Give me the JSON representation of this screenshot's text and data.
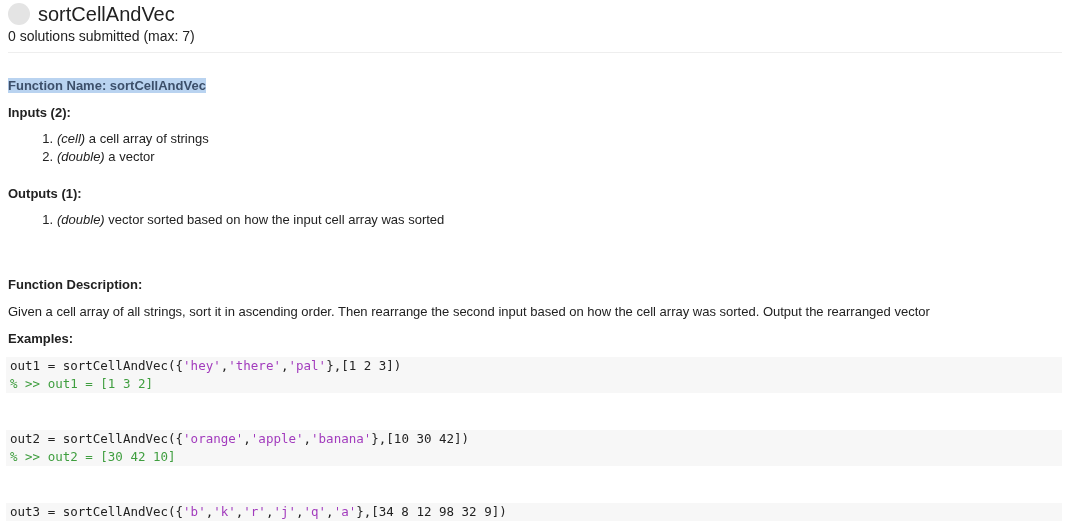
{
  "header": {
    "title": "sortCellAndVec",
    "subtitle": "0 solutions submitted (max: 7)"
  },
  "function_name": {
    "text": "Function Name: sortCellAndVec",
    "selected": true
  },
  "inputs": {
    "heading": "Inputs (2):",
    "items": [
      {
        "marker": "1.",
        "type": "(cell)",
        "text": "a cell array of strings"
      },
      {
        "marker": "2.",
        "type": "(double)",
        "text": "a vector"
      }
    ]
  },
  "outputs": {
    "heading": "Outputs (1):",
    "items": [
      {
        "marker": "1.",
        "type": "(double)",
        "text": "vector sorted based on how the input cell array was sorted"
      }
    ]
  },
  "description": {
    "heading": "Function Description:",
    "text": "Given a cell array of all strings, sort it in ascending order. Then rearrange the second input based on how the cell array was sorted. Output the rearranged vector"
  },
  "examples": {
    "heading": "Examples:",
    "blocks": [
      {
        "lines": [
          [
            {
              "kind": "plain",
              "text": "out1 = sortCellAndVec({"
            },
            {
              "kind": "string",
              "text": "'hey'"
            },
            {
              "kind": "plain",
              "text": ","
            },
            {
              "kind": "string",
              "text": "'there'"
            },
            {
              "kind": "plain",
              "text": ","
            },
            {
              "kind": "string",
              "text": "'pal'"
            },
            {
              "kind": "plain",
              "text": "},[1 2 3])"
            }
          ],
          [
            {
              "kind": "comment",
              "text": "% >> out1 = [1 3 2]"
            }
          ]
        ]
      },
      {
        "lines": [
          [
            {
              "kind": "plain",
              "text": "out2 = sortCellAndVec({"
            },
            {
              "kind": "string",
              "text": "'orange'"
            },
            {
              "kind": "plain",
              "text": ","
            },
            {
              "kind": "string",
              "text": "'apple'"
            },
            {
              "kind": "plain",
              "text": ","
            },
            {
              "kind": "string",
              "text": "'banana'"
            },
            {
              "kind": "plain",
              "text": "},[10 30 42])"
            }
          ],
          [
            {
              "kind": "comment",
              "text": "% >> out2 = [30 42 10]"
            }
          ]
        ]
      },
      {
        "lines": [
          [
            {
              "kind": "plain",
              "text": "out3 = sortCellAndVec({"
            },
            {
              "kind": "string",
              "text": "'b'"
            },
            {
              "kind": "plain",
              "text": ","
            },
            {
              "kind": "string",
              "text": "'k'"
            },
            {
              "kind": "plain",
              "text": ","
            },
            {
              "kind": "string",
              "text": "'r'"
            },
            {
              "kind": "plain",
              "text": ","
            },
            {
              "kind": "string",
              "text": "'j'"
            },
            {
              "kind": "plain",
              "text": ","
            },
            {
              "kind": "string",
              "text": "'q'"
            },
            {
              "kind": "plain",
              "text": ","
            },
            {
              "kind": "string",
              "text": "'a'"
            },
            {
              "kind": "plain",
              "text": "},[34 8 12 98 32 9])"
            }
          ]
        ]
      }
    ]
  }
}
